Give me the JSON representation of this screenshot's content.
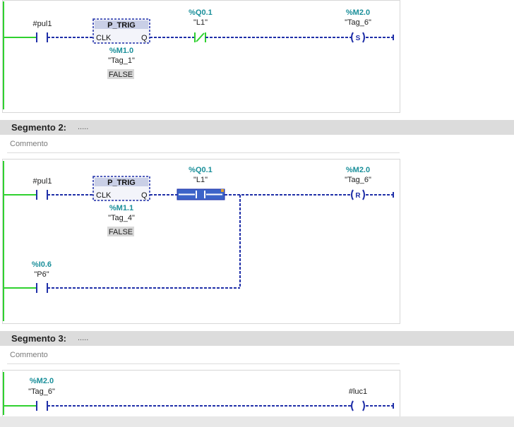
{
  "segment1": {
    "input_contact": {
      "name": "#pul1"
    },
    "ptrig": {
      "title": "P_TRIG",
      "pin_in": "CLK",
      "pin_out": "Q",
      "address": "%M1.0",
      "tag": "\"Tag_1\"",
      "value": "FALSE"
    },
    "contact2": {
      "address": "%Q0.1",
      "tag": "\"L1\""
    },
    "coil": {
      "address": "%M2.0",
      "tag": "\"Tag_6\"",
      "type": "S"
    }
  },
  "segment2": {
    "title": "Segmento 2:",
    "dots": ".....",
    "comment": "Commento",
    "input_contact": {
      "name": "#pul1"
    },
    "ptrig": {
      "title": "P_TRIG",
      "pin_in": "CLK",
      "pin_out": "Q",
      "address": "%M1.1",
      "tag": "\"Tag_4\"",
      "value": "FALSE"
    },
    "contact2": {
      "address": "%Q0.1",
      "tag": "\"L1\""
    },
    "coil": {
      "address": "%M2.0",
      "tag": "\"Tag_6\"",
      "type": "R"
    },
    "branch_contact": {
      "address": "%I0.6",
      "tag": "\"P6\""
    }
  },
  "segment3": {
    "title": "Segmento 3:",
    "dots": ".....",
    "comment": "Commento",
    "input_contact": {
      "address": "%M2.0",
      "tag": "\"Tag_6\""
    },
    "coil": {
      "name": "#luc1"
    }
  },
  "colors": {
    "wire": "#1f2fa8",
    "rail": "#2fd12f",
    "address": "#1a8f9a",
    "selection": "#3c64c8"
  }
}
